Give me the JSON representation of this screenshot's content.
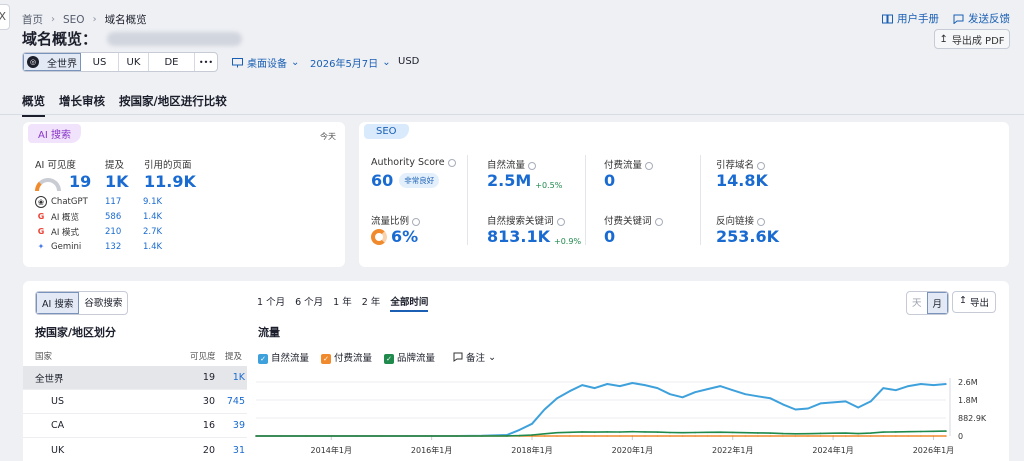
{
  "window": {
    "close_glyph": "X"
  },
  "breadcrumb": {
    "items": [
      "首页",
      "SEO",
      "域名概览"
    ]
  },
  "top_links": {
    "manual": "用户手册",
    "feedback": "发送反馈"
  },
  "header": {
    "title": "域名概览：",
    "export_pdf": "导出成 PDF"
  },
  "region_selector": {
    "items": [
      "全世界",
      "US",
      "UK",
      "DE"
    ],
    "more": "•••",
    "selected": "全世界"
  },
  "device_dropdown": "桌面设备",
  "date_dropdown": "2026年5月7日",
  "currency": "USD",
  "tabs": [
    "概览",
    "增长审核",
    "按国家/地区进行比较"
  ],
  "ai_panel": {
    "pill": "AI 搜索",
    "today": "今天",
    "headers": [
      "AI 可见度",
      "提及",
      "引用的页面"
    ],
    "visibility": "19",
    "mentions": "1K",
    "cited_pages": "11.9K",
    "sources": [
      {
        "name": "ChatGPT",
        "mentions": "117",
        "pages": "9.1K"
      },
      {
        "name": "AI 概览",
        "mentions": "586",
        "pages": "1.4K"
      },
      {
        "name": "AI 模式",
        "mentions": "210",
        "pages": "2.7K"
      },
      {
        "name": "Gemini",
        "mentions": "132",
        "pages": "1.4K"
      }
    ]
  },
  "seo_panel": {
    "pill": "SEO",
    "authority_label": "Authority Score",
    "authority_value": "60",
    "authority_badge": "非常良好",
    "organic_label": "自然流量",
    "organic_value": "2.5M",
    "organic_change": "+0.5%",
    "paid_label": "付费流量",
    "paid_value": "0",
    "ref_domains_label": "引荐域名",
    "ref_domains_value": "14.8K",
    "traffic_share_label": "流量比例",
    "traffic_share_value": "6%",
    "organic_kw_label": "自然搜索关键词",
    "organic_kw_value": "813.1K",
    "organic_kw_change": "+0.9%",
    "paid_kw_label": "付费关键词",
    "paid_kw_value": "0",
    "backlinks_label": "反向链接",
    "backlinks_value": "253.6K"
  },
  "bottom": {
    "source_toggle": [
      "AI 搜索",
      "谷歌搜索"
    ],
    "periods": [
      "1 个月",
      "6 个月",
      "1 年",
      "2 年",
      "全部时间"
    ],
    "period_selected": "全部时间",
    "granularity": [
      "天",
      "月"
    ],
    "export": "导出",
    "country_title": "按国家/地区划分",
    "table_headers": [
      "国家",
      "可见度",
      "提及"
    ],
    "rows": [
      {
        "country": "全世界",
        "visibility": "19",
        "mentions": "1K"
      },
      {
        "country": "US",
        "visibility": "30",
        "mentions": "745"
      },
      {
        "country": "CA",
        "visibility": "16",
        "mentions": "39"
      },
      {
        "country": "UK",
        "visibility": "20",
        "mentions": "31"
      }
    ],
    "traffic_title": "流量",
    "legend": [
      "自然流量",
      "付费流量",
      "品牌流量"
    ],
    "notes": "备注"
  },
  "colors": {
    "organic": "#3fa1dc",
    "paid": "#f08a2c",
    "brand": "#1f8a4c",
    "accent": "#1a6bd1"
  },
  "chart_data": {
    "type": "line",
    "x_ticks": [
      "2014年1月",
      "2016年1月",
      "2018年1月",
      "2020年1月",
      "2022年1月",
      "2024年1月",
      "2026年1月"
    ],
    "y_ticks": [
      "2.6M",
      "1.8M",
      "882.9K",
      "0"
    ],
    "ylim": [
      0,
      2650000
    ],
    "x": [
      "2012-07",
      "2013-01",
      "2013-07",
      "2014-01",
      "2014-07",
      "2015-01",
      "2015-07",
      "2016-01",
      "2016-07",
      "2017-01",
      "2017-07",
      "2017-10",
      "2018-01",
      "2018-04",
      "2018-07",
      "2018-10",
      "2019-01",
      "2019-04",
      "2019-07",
      "2019-10",
      "2020-01",
      "2020-04",
      "2020-07",
      "2020-10",
      "2021-01",
      "2021-04",
      "2021-07",
      "2021-10",
      "2022-01",
      "2022-04",
      "2022-07",
      "2022-10",
      "2023-01",
      "2023-04",
      "2023-07",
      "2023-10",
      "2024-01",
      "2024-04",
      "2024-07",
      "2024-10",
      "2025-01",
      "2025-04",
      "2025-07",
      "2025-10",
      "2026-01",
      "2026-04"
    ],
    "series": [
      {
        "name": "自然流量",
        "values": [
          0,
          0,
          0,
          0,
          0,
          0,
          0,
          0,
          0,
          10000,
          50000,
          300000,
          600000,
          1300000,
          1850000,
          2200000,
          2500000,
          2350000,
          2550000,
          2450000,
          2600000,
          2500000,
          2350000,
          2050000,
          1900000,
          2150000,
          2300000,
          2450000,
          2250000,
          2050000,
          1950000,
          1850000,
          1550000,
          1300000,
          1350000,
          1600000,
          1650000,
          1700000,
          1400000,
          1700000,
          2350000,
          2250000,
          2450000,
          2550000,
          2500000,
          2550000
        ]
      },
      {
        "name": "付费流量",
        "values": [
          0,
          0,
          0,
          0,
          0,
          0,
          0,
          0,
          0,
          0,
          0,
          0,
          0,
          0,
          0,
          0,
          0,
          0,
          0,
          0,
          0,
          0,
          0,
          0,
          0,
          0,
          0,
          0,
          0,
          0,
          0,
          0,
          0,
          0,
          0,
          0,
          0,
          0,
          0,
          0,
          0,
          0,
          0,
          0,
          0,
          0
        ]
      },
      {
        "name": "品牌流量",
        "values": [
          0,
          0,
          0,
          0,
          0,
          0,
          0,
          0,
          0,
          0,
          5000,
          20000,
          50000,
          110000,
          160000,
          180000,
          200000,
          190000,
          200000,
          195000,
          210000,
          200000,
          190000,
          170000,
          160000,
          170000,
          180000,
          185000,
          175000,
          160000,
          150000,
          140000,
          120000,
          110000,
          112000,
          130000,
          135000,
          140000,
          120000,
          140000,
          190000,
          200000,
          210000,
          220000,
          230000,
          240000
        ]
      }
    ]
  }
}
